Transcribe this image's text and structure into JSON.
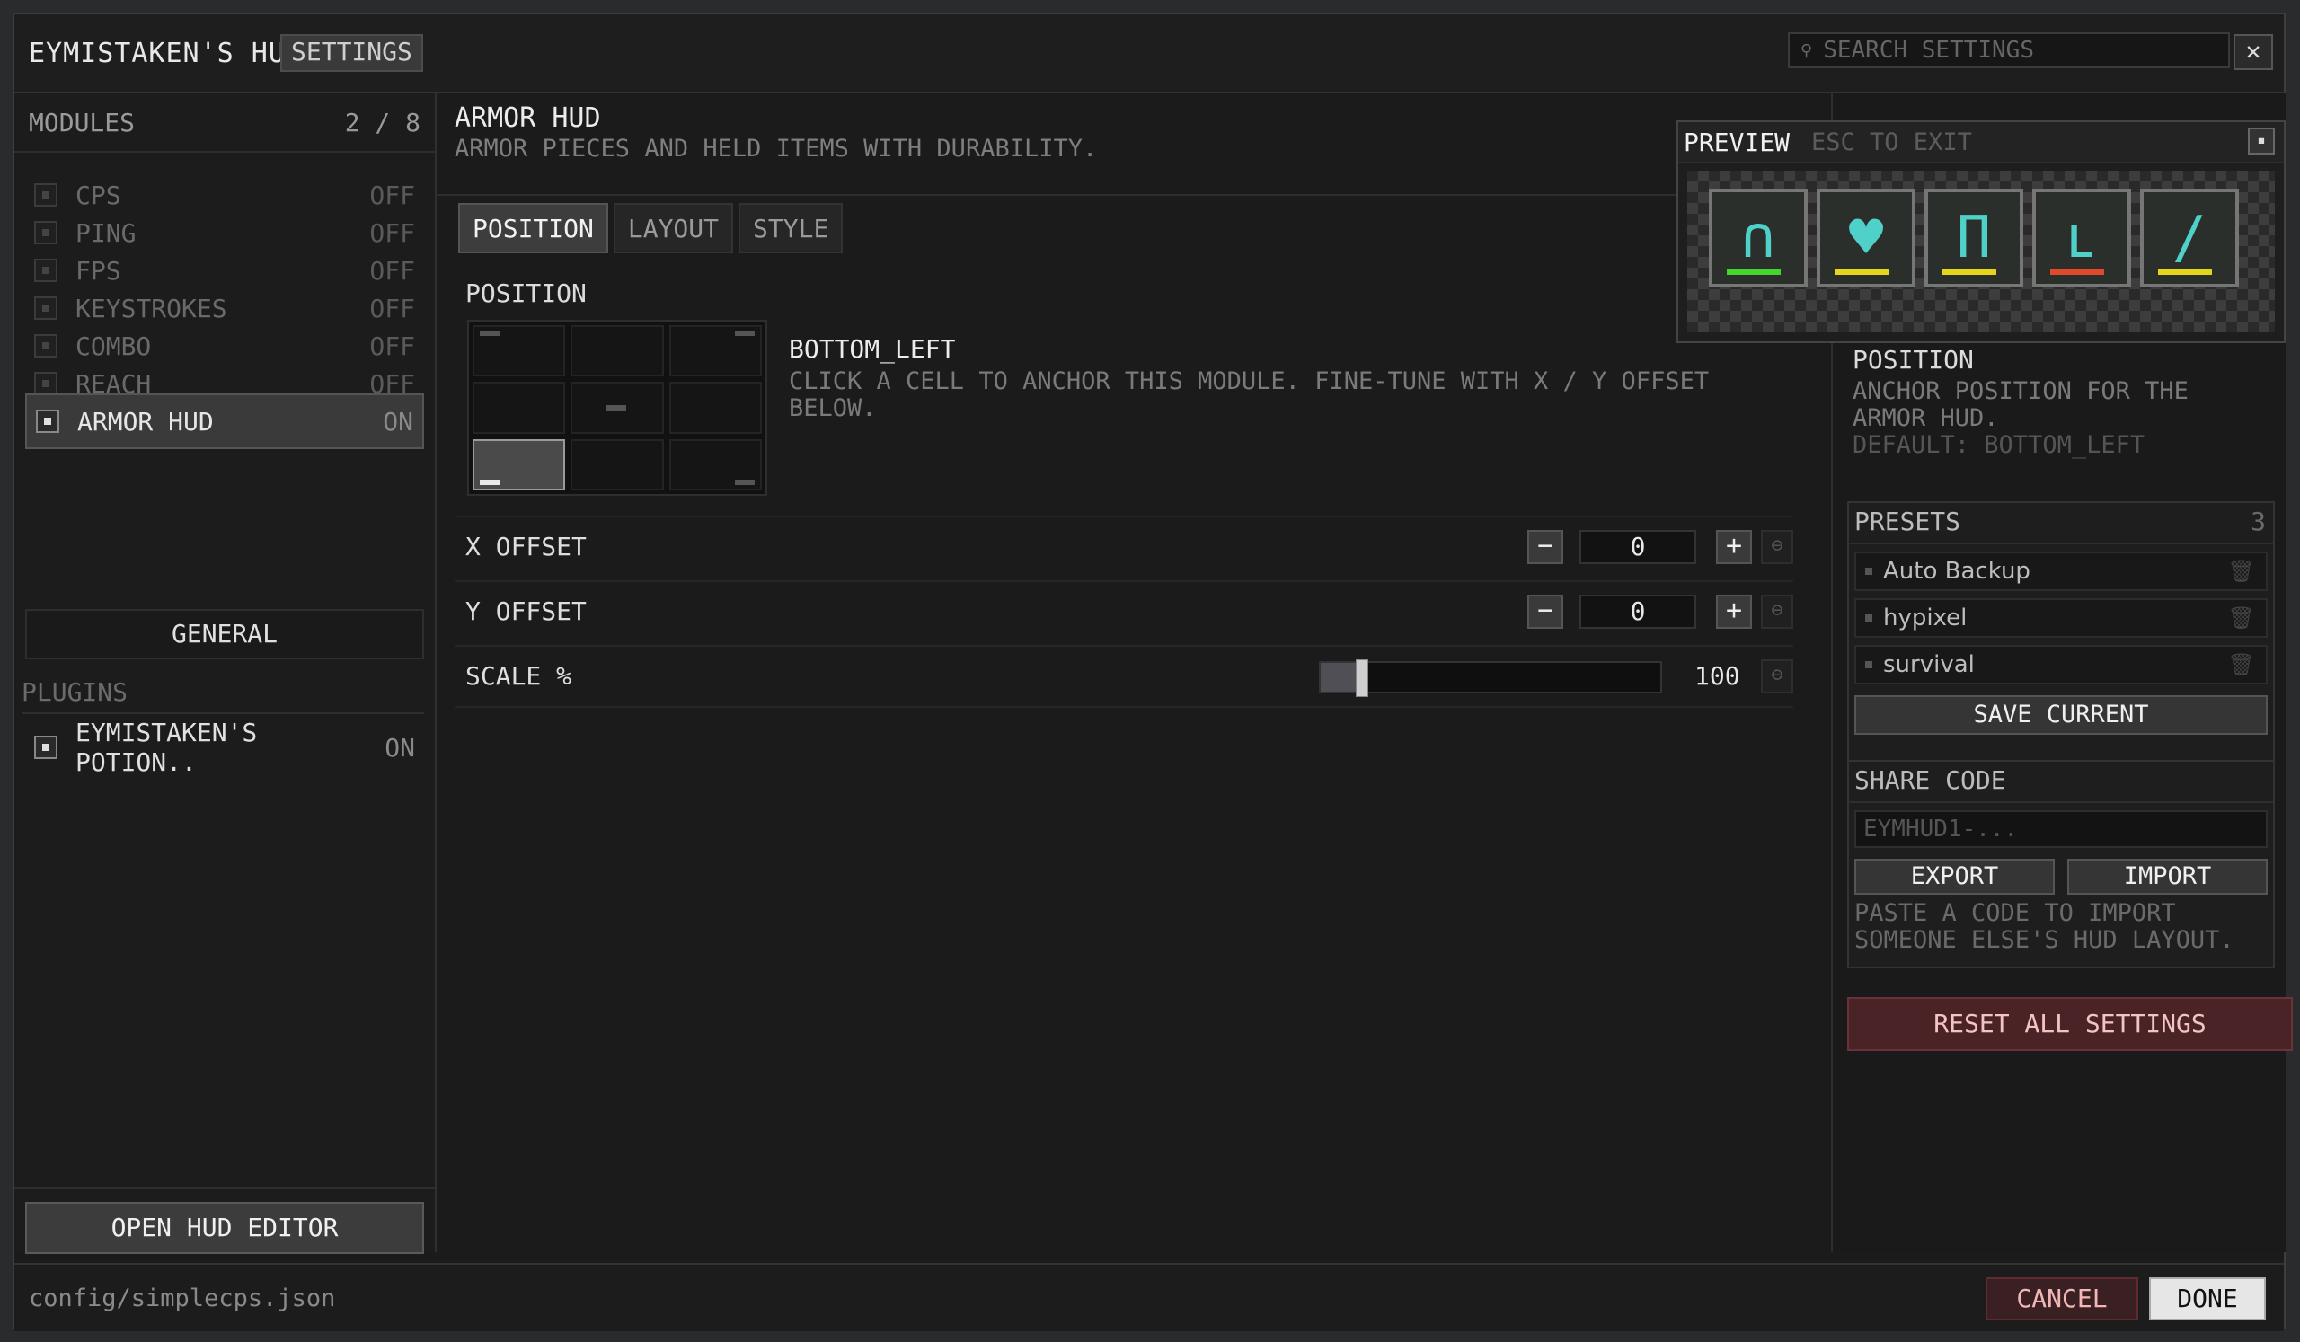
{
  "titlebar": {
    "app_title": "EYMISTAKEN'S HUD",
    "tag": "SETTINGS",
    "search_placeholder": "SEARCH SETTINGS",
    "close_glyph": "✕"
  },
  "sidebar": {
    "header": "MODULES",
    "count": "2 / 8",
    "modules": [
      {
        "label": "CPS",
        "state": "OFF"
      },
      {
        "label": "PING",
        "state": "OFF"
      },
      {
        "label": "FPS",
        "state": "OFF"
      },
      {
        "label": "KEYSTROKES",
        "state": "OFF"
      },
      {
        "label": "COMBO",
        "state": "OFF"
      },
      {
        "label": "REACH",
        "state": "OFF"
      },
      {
        "label": "ARMOR HUD",
        "state": "ON"
      }
    ],
    "general": "GENERAL",
    "plugins_label": "PLUGINS",
    "plugin": {
      "label": "EYMISTAKEN'S POTION..",
      "state": "ON"
    },
    "open_editor": "OPEN HUD EDITOR"
  },
  "main": {
    "title": "ARMOR HUD",
    "description": "ARMOR PIECES AND HELD ITEMS WITH DURABILITY.",
    "tabs": [
      "POSITION",
      "LAYOUT",
      "STYLE"
    ],
    "section": "POSITION",
    "anchor_value": "BOTTOM_LEFT",
    "anchor_help": "CLICK A CELL TO ANCHOR THIS MODULE. FINE-TUNE WITH X / Y OFFSET BELOW.",
    "x_offset": {
      "label": "X OFFSET",
      "value": "0"
    },
    "y_offset": {
      "label": "Y OFFSET",
      "value": "0"
    },
    "scale": {
      "label": "SCALE %",
      "value": "100",
      "fraction": 0.12
    },
    "minus": "−",
    "plus": "+",
    "reset_glyph": "⊖"
  },
  "preview": {
    "title": "PREVIEW",
    "hint": "ESC TO EXIT",
    "icon": "expand-icon",
    "slots": [
      {
        "icon": "diamond-helmet-icon",
        "glyph": "∩",
        "durability_color": "#44d62c"
      },
      {
        "icon": "diamond-chestplate-icon",
        "glyph": "♥",
        "durability_color": "#e6d61a"
      },
      {
        "icon": "diamond-leggings-icon",
        "glyph": "Π",
        "durability_color": "#e6d61a"
      },
      {
        "icon": "diamond-boots-icon",
        "glyph": "ʟ",
        "durability_color": "#e04a2a"
      },
      {
        "icon": "diamond-sword-icon",
        "glyph": "/",
        "durability_color": "#e6d61a"
      }
    ]
  },
  "right": {
    "position_title": "POSITION",
    "position_desc": "ANCHOR POSITION FOR THE ARMOR HUD.",
    "position_default": "DEFAULT: BOTTOM_LEFT",
    "presets_title": "PRESETS",
    "presets_count": "3",
    "presets": [
      "Auto Backup",
      "hypixel",
      "survival"
    ],
    "save_current": "SAVE CURRENT",
    "share_title": "SHARE CODE",
    "share_placeholder": "EYMHUD1-...",
    "export": "EXPORT",
    "import": "IMPORT",
    "share_help": "PASTE A CODE TO IMPORT SOMEONE ELSE'S HUD LAYOUT.",
    "reset_all": "RESET ALL SETTINGS"
  },
  "footer": {
    "config_path": "config/simplecps.json",
    "cancel": "CANCEL",
    "done": "DONE"
  }
}
